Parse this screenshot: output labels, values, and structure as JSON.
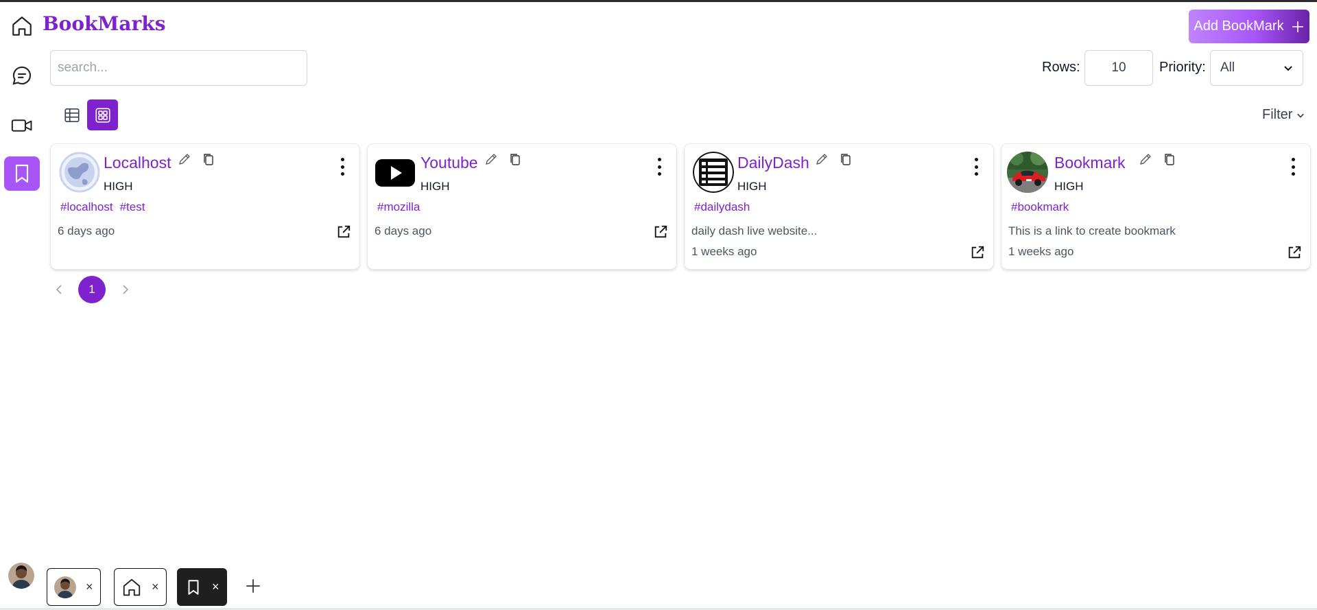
{
  "header": {
    "brand": "BookMarks",
    "add_button_label": "Add BookMark"
  },
  "toolbar": {
    "search_placeholder": "search...",
    "rows_label": "Rows:",
    "rows_value": "10",
    "priority_label": "Priority:",
    "priority_value": "All",
    "filter_label": "Filter"
  },
  "sidebar": {
    "items": [
      {
        "icon": "home-icon"
      },
      {
        "icon": "chat-icon"
      },
      {
        "icon": "video-icon"
      },
      {
        "icon": "bookmark-icon",
        "active": true
      }
    ]
  },
  "view_modes": {
    "active": "grid"
  },
  "cards": [
    {
      "title": "Localhost",
      "priority": "HIGH",
      "tags": [
        "#localhost",
        "#test"
      ],
      "description": "",
      "time": "6 days ago",
      "logo": "globe-logo"
    },
    {
      "title": "Youtube",
      "priority": "HIGH",
      "tags": [
        "#mozilla"
      ],
      "description": "",
      "time": "6 days ago",
      "logo": "youtube-logo"
    },
    {
      "title": "DailyDash",
      "priority": "HIGH",
      "tags": [
        "#dailydash"
      ],
      "description": "daily dash live website...",
      "time": "1 weeks ago",
      "logo": "list-logo"
    },
    {
      "title": "Bookmark",
      "priority": "HIGH",
      "tags": [
        "#bookmark"
      ],
      "description": "This is a link to create bookmark",
      "time": "1 weeks ago",
      "logo": "red-car-logo"
    }
  ],
  "pagination": {
    "current_page": "1"
  },
  "bottom_tabs": {
    "close_symbol": "×",
    "add_symbol": "+"
  },
  "colors": {
    "accent": "#7e22ce",
    "accent_light": "#a855f7"
  }
}
